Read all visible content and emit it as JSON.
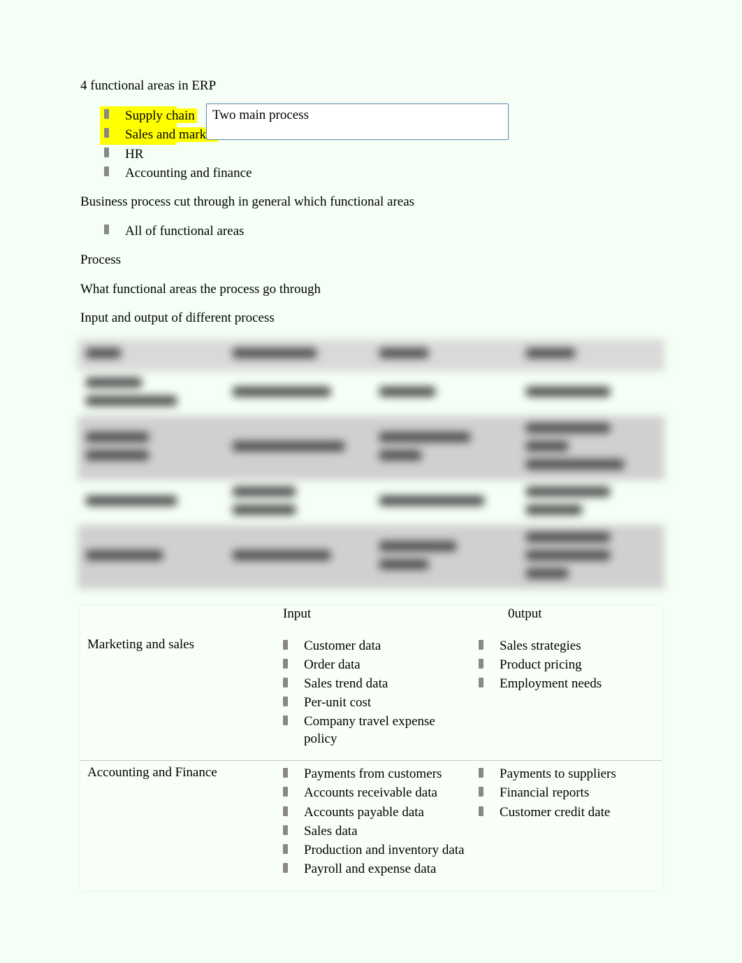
{
  "title": "4 functional areas in ERP",
  "functional_areas": {
    "items": [
      {
        "label": "Supply chain",
        "highlighted": true
      },
      {
        "label": "Sales and market",
        "highlighted": true
      },
      {
        "label": "HR",
        "highlighted": false
      },
      {
        "label": "Accounting and finance",
        "highlighted": false
      }
    ],
    "callout": "Two main process"
  },
  "q1": {
    "prompt": "Business process cut through in general which functional areas",
    "answer": "All of functional areas"
  },
  "section_process": "Process",
  "line_what_fa": "What functional areas the process go through",
  "line_io": "Input and output of different process",
  "io_table": {
    "headers": {
      "input": "Input",
      "output": "0utput"
    },
    "rows": [
      {
        "area": "Marketing and sales",
        "inputs": [
          "Customer data",
          "Order data",
          "Sales trend data",
          "Per-unit cost",
          "Company travel expense policy"
        ],
        "outputs": [
          "Sales strategies",
          "Product pricing",
          "Employment needs"
        ]
      },
      {
        "area": "Accounting and Finance",
        "inputs": [
          "Payments from customers",
          "Accounts receivable data",
          "Accounts payable data",
          "Sales data",
          "Production and inventory data",
          "Payroll and expense data"
        ],
        "outputs": [
          "Payments to suppliers",
          "Financial reports",
          "Customer credit date"
        ]
      }
    ]
  }
}
